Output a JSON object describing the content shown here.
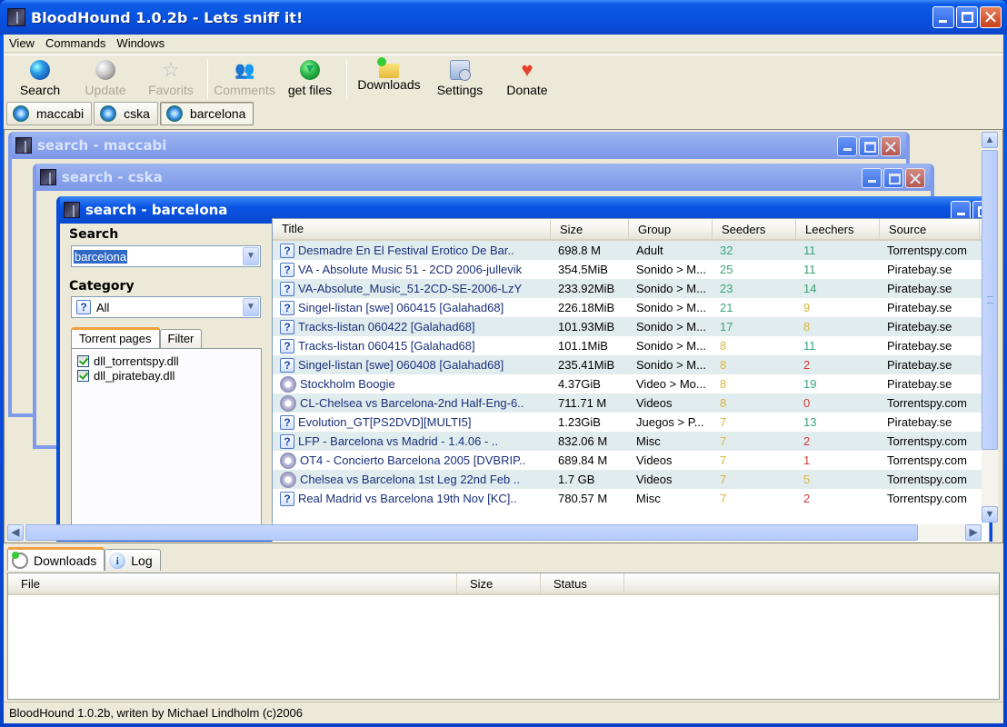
{
  "window": {
    "title": "BloodHound 1.0.2b - Lets sniff it!",
    "controls": [
      "minimize",
      "maximize",
      "close"
    ]
  },
  "menu": [
    "View",
    "Commands",
    "Windows"
  ],
  "toolbar": [
    {
      "label": "Search",
      "icon": "globe-icon",
      "enabled": true
    },
    {
      "label": "Update",
      "icon": "update-icon",
      "enabled": false
    },
    {
      "label": "Favorits",
      "icon": "star-icon",
      "enabled": false
    },
    {
      "label": "Comments",
      "icon": "people-icon",
      "enabled": false
    },
    {
      "label": "get files",
      "icon": "get-files-icon",
      "enabled": true
    },
    {
      "label": "Downloads",
      "icon": "folder-icon",
      "enabled": true
    },
    {
      "label": "Settings",
      "icon": "settings-icon",
      "enabled": true
    },
    {
      "label": "Donate",
      "icon": "heart-icon",
      "enabled": true
    }
  ],
  "search_tabs": [
    {
      "label": "maccabi",
      "active": false
    },
    {
      "label": "cska",
      "active": false
    },
    {
      "label": "barcelona",
      "active": true
    }
  ],
  "child_windows": {
    "maccabi": {
      "title": "search - maccabi"
    },
    "cska": {
      "title": "search - cska"
    },
    "barcelona": {
      "title": "search - barcelona",
      "search_label": "Search",
      "search_value": "barcelona",
      "category_label": "Category",
      "category_value": "All",
      "tabs": [
        "Torrent pages",
        "Filter"
      ],
      "active_tab": "Torrent pages",
      "plugins": [
        {
          "name": "dll_torrentspy.dll",
          "checked": true
        },
        {
          "name": "dll_piratebay.dll",
          "checked": true
        }
      ],
      "results": {
        "columns": [
          "Title",
          "Size",
          "Group",
          "Seeders",
          "Leechers",
          "Source"
        ],
        "rows": [
          {
            "icon": "unknown",
            "title": "Desmadre En El Festival Erotico De Bar..",
            "size": "698.8 M",
            "group": "Adult",
            "seeders": "32",
            "leechers": "11",
            "source": "Torrentspy.com"
          },
          {
            "icon": "unknown",
            "title": "VA - Absolute Music 51 - 2CD 2006-jullevik",
            "size": "354.5MiB",
            "group": "Sonido > M...",
            "seeders": "25",
            "leechers": "11",
            "source": "Piratebay.se"
          },
          {
            "icon": "unknown",
            "title": "VA-Absolute_Music_51-2CD-SE-2006-LzY",
            "size": "233.92MiB",
            "group": "Sonido > M...",
            "seeders": "23",
            "leechers": "14",
            "source": "Piratebay.se"
          },
          {
            "icon": "unknown",
            "title": "Singel-listan [swe] 060415 [Galahad68]",
            "size": "226.18MiB",
            "group": "Sonido > M...",
            "seeders": "21",
            "leechers": "9",
            "source": "Piratebay.se"
          },
          {
            "icon": "unknown",
            "title": "Tracks-listan 060422 [Galahad68]",
            "size": "101.93MiB",
            "group": "Sonido > M...",
            "seeders": "17",
            "leechers": "8",
            "source": "Piratebay.se"
          },
          {
            "icon": "unknown",
            "title": "Tracks-listan 060415 [Galahad68]",
            "size": "101.1MiB",
            "group": "Sonido > M...",
            "seeders": "8",
            "leechers": "11",
            "source": "Piratebay.se"
          },
          {
            "icon": "unknown",
            "title": "Singel-listan [swe] 060408 [Galahad68]",
            "size": "235.41MiB",
            "group": "Sonido > M...",
            "seeders": "8",
            "leechers": "2",
            "source": "Piratebay.se"
          },
          {
            "icon": "disc",
            "title": "Stockholm Boogie",
            "size": "4.37GiB",
            "group": "Video > Mo...",
            "seeders": "8",
            "leechers": "19",
            "source": "Piratebay.se"
          },
          {
            "icon": "disc",
            "title": "CL-Chelsea vs Barcelona-2nd Half-Eng-6..",
            "size": "711.71 M",
            "group": "Videos",
            "seeders": "8",
            "leechers": "0",
            "source": "Torrentspy.com"
          },
          {
            "icon": "unknown",
            "title": "Evolution_GT[PS2DVD][MULTI5]",
            "size": "1.23GiB",
            "group": "Juegos > P...",
            "seeders": "7",
            "leechers": "13",
            "source": "Piratebay.se"
          },
          {
            "icon": "unknown",
            "title": "LFP - Barcelona vs Madrid - 1.4.06 - ..",
            "size": "832.06 M",
            "group": "Misc",
            "seeders": "7",
            "leechers": "2",
            "source": "Torrentspy.com"
          },
          {
            "icon": "disc",
            "title": "OT4 - Concierto Barcelona 2005 [DVBRIP..",
            "size": "689.84 M",
            "group": "Videos",
            "seeders": "7",
            "leechers": "1",
            "source": "Torrentspy.com"
          },
          {
            "icon": "disc",
            "title": "Chelsea vs Barcelona 1st Leg 22nd Feb ..",
            "size": "1.7 GB",
            "group": "Videos",
            "seeders": "7",
            "leechers": "5",
            "source": "Torrentspy.com"
          },
          {
            "icon": "unknown",
            "title": "Real Madrid vs Barcelona 19th Nov [KC]..",
            "size": "780.57 M",
            "group": "Misc",
            "seeders": "7",
            "leechers": "2",
            "source": "Torrentspy.com"
          }
        ]
      }
    }
  },
  "count_colors": {
    "high": "#3aa37a",
    "mid": "#d9b53a",
    "low": "#d23a3a"
  },
  "bottom_panel": {
    "tabs": [
      {
        "label": "Downloads",
        "icon": "clock-icon",
        "active": true
      },
      {
        "label": "Log",
        "icon": "info-icon",
        "active": false
      }
    ],
    "columns": [
      "File",
      "Size",
      "Status"
    ],
    "rows": []
  },
  "status_bar": "BloodHound 1.0.2b, writen by Michael Lindholm (c)2006"
}
